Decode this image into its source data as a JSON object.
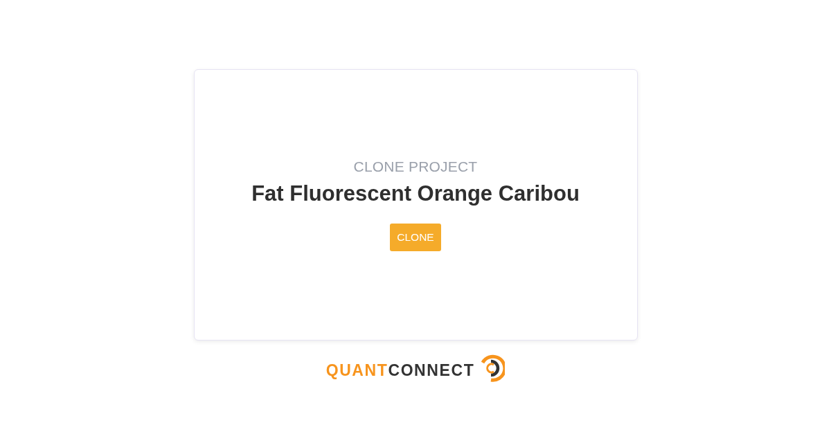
{
  "card": {
    "subtitle": "CLONE PROJECT",
    "title": "Fat Fluorescent Orange Caribou",
    "button": "CLONE"
  },
  "logo": {
    "accent_text": "QUANT",
    "main_text": "CONNECT"
  }
}
